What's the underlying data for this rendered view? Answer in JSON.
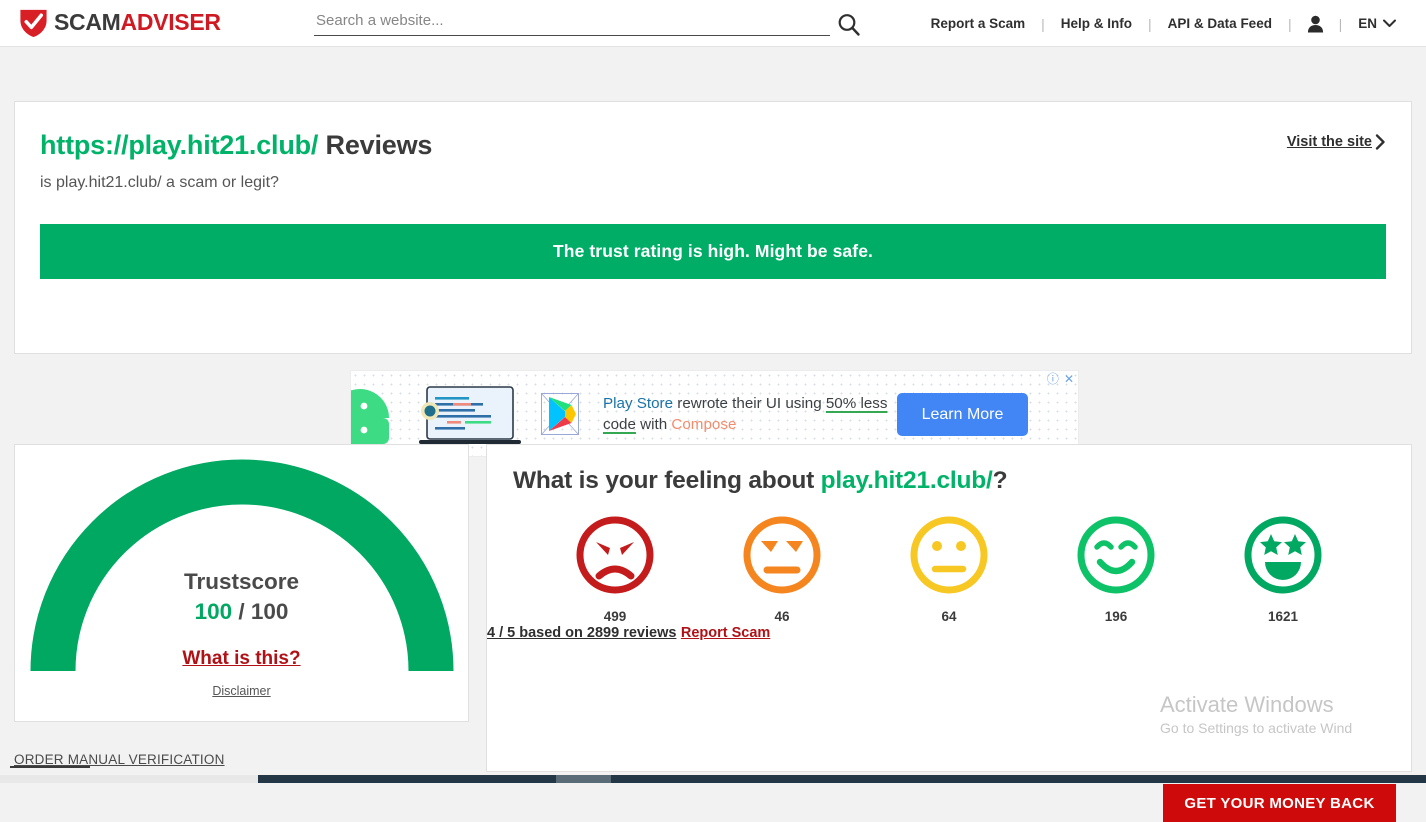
{
  "header": {
    "logo": {
      "part1": "SCAM",
      "part2": "ADVISER",
      "icon": "shield-check-icon"
    },
    "search": {
      "placeholder": "Search a website...",
      "value": "",
      "icon": "search-icon"
    },
    "nav": [
      {
        "label": "Report a Scam",
        "name": "nav-report-a-scam"
      },
      {
        "label": "Help & Info",
        "name": "nav-help-info"
      },
      {
        "label": "API & Data Feed",
        "name": "nav-api-data-feed"
      }
    ],
    "separator": "|",
    "account_icon": "user-icon",
    "language": {
      "label": "EN",
      "icon": "chevron-down-icon"
    }
  },
  "overview": {
    "title_url": "https://play.hit21.club/",
    "title_suffix": " Reviews",
    "subtitle": "is play.hit21.club/ a scam or legit?",
    "visit_site": "Visit the site",
    "visit_site_icon": "chevron-right-icon",
    "trust_banner": "The trust rating is high. Might be safe.",
    "trust_banner_color": "#00ad66"
  },
  "ad": {
    "headline_part1": "Play Store",
    "headline_part2": " rewrote their UI using ",
    "headline_part3": "50% less code",
    "headline_part4": " with ",
    "headline_part5": "Compose",
    "cta": "Learn More",
    "info_icon": "ad-info-icon",
    "close_icon": "ad-close-icon",
    "brand_icons": [
      "android-icon",
      "laptop-icon",
      "google-play-icon"
    ]
  },
  "trustscore": {
    "label": "Trustscore",
    "score": "100",
    "separator": " / ",
    "max": "100",
    "what_is_this": "What is this?",
    "disclaimer": "Disclaimer",
    "gauge_color": "#00a862",
    "gauge_percent": 100
  },
  "feeling": {
    "title_prefix": "What is your feeling about ",
    "title_url": "play.hit21.club/",
    "title_suffix": "?",
    "faces": [
      {
        "name": "face-angry",
        "icon": "angry-face-icon",
        "count": "499",
        "color": "#c41c1c"
      },
      {
        "name": "face-annoyed",
        "icon": "annoyed-face-icon",
        "count": "46",
        "color": "#f5861f"
      },
      {
        "name": "face-neutral",
        "icon": "neutral-face-icon",
        "count": "64",
        "color": "#f7c824"
      },
      {
        "name": "face-happy",
        "icon": "happy-face-icon",
        "count": "196",
        "color": "#0ec268"
      },
      {
        "name": "face-star-struck",
        "icon": "star-struck-face-icon",
        "count": "1621",
        "color": "#00a862"
      }
    ],
    "reviews_summary": "4 / 5 based on 2899 reviews",
    "report_scam": "Report Scam"
  },
  "footer": {
    "order_manual_verification": "ORDER MANUAL VERIFICATION",
    "money_back": "GET YOUR MONEY BACK"
  },
  "watermark": {
    "title": "Activate Windows",
    "subtitle": "Go to Settings to activate Wind"
  }
}
